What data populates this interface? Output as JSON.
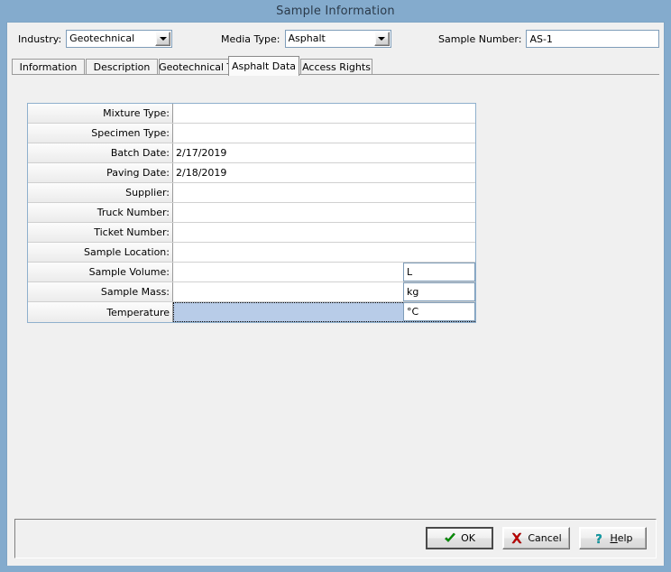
{
  "window": {
    "title": "Sample Information",
    "titlebar_color": "#84abcd",
    "body_color": "#f0f0f0",
    "accent_selection_color": "#b8cce8"
  },
  "header": {
    "industry": {
      "label": "Industry:",
      "value": "Geotechnical",
      "arrow_icon": "chevron-down-icon"
    },
    "media_type": {
      "label": "Media Type:",
      "value": "Asphalt",
      "arrow_icon": "chevron-down-icon"
    },
    "sample_number": {
      "label": "Sample Number:",
      "value": "AS-1"
    }
  },
  "tabs": [
    {
      "label": "Information",
      "active": false
    },
    {
      "label": "Description",
      "active": false
    },
    {
      "label": "Geotechnical Tests",
      "active": false
    },
    {
      "label": "Asphalt Data",
      "active": true
    },
    {
      "label": "Access Rights",
      "active": false
    }
  ],
  "grid": {
    "rows": [
      {
        "label": "Mixture Type:",
        "value": "",
        "unit": null,
        "selected": false
      },
      {
        "label": "Specimen Type:",
        "value": "",
        "unit": null,
        "selected": false
      },
      {
        "label": "Batch Date:",
        "value": "2/17/2019",
        "unit": null,
        "selected": false
      },
      {
        "label": "Paving Date:",
        "value": "2/18/2019",
        "unit": null,
        "selected": false
      },
      {
        "label": "Supplier:",
        "value": "",
        "unit": null,
        "selected": false
      },
      {
        "label": "Truck Number:",
        "value": "",
        "unit": null,
        "selected": false
      },
      {
        "label": "Ticket Number:",
        "value": "",
        "unit": null,
        "selected": false
      },
      {
        "label": "Sample Location:",
        "value": "",
        "unit": null,
        "selected": false
      },
      {
        "label": "Sample Volume:",
        "value": "",
        "unit": "L",
        "selected": false
      },
      {
        "label": "Sample Mass:",
        "value": "",
        "unit": "kg",
        "selected": false
      },
      {
        "label": "Temperature",
        "value": "",
        "unit": "°C",
        "selected": true
      }
    ]
  },
  "buttons": {
    "ok": {
      "label": "OK",
      "icon": "green-check-icon",
      "icon_color": "#00a000"
    },
    "cancel": {
      "label": "Cancel",
      "icon": "red-x-icon",
      "icon_color": "#c00000"
    },
    "help": {
      "label": "Help",
      "accelerator": "H",
      "icon": "question-mark-icon",
      "icon_color": "#0f9fa8"
    }
  }
}
